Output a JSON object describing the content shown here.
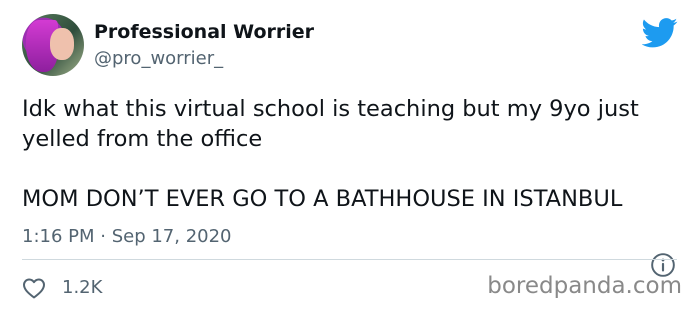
{
  "user": {
    "display_name": "Professional Worrier",
    "handle": "@pro_worrier_"
  },
  "tweet": {
    "line_1": "Idk what this virtual school is teaching but my 9yo just yelled from the office",
    "line_2": "MOM DON’T EVER GO TO A BATHHOUSE IN ISTANBUL",
    "timestamp": "1:16 PM · Sep 17, 2020",
    "likes": "1.2K"
  },
  "icons": {
    "brand": "twitter-bird-icon",
    "info": "info-icon",
    "like": "heart-icon"
  },
  "watermark": "boredpanda.com",
  "colors": {
    "twitter_blue": "#1d9bf0",
    "secondary_text": "#536471",
    "divider": "#cfd9de"
  }
}
